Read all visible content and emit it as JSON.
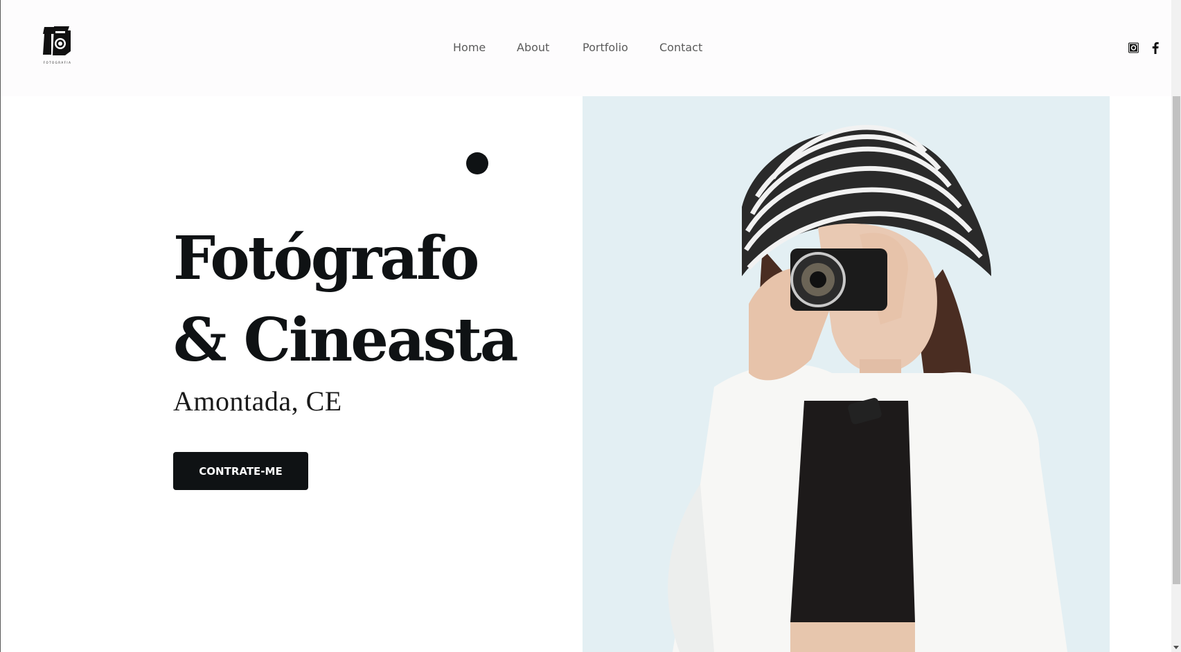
{
  "header": {
    "logo_icon": "camera-logo-icon",
    "logo_caption": "FOTOGRAFIA",
    "nav": [
      {
        "label": "Home"
      },
      {
        "label": "About"
      },
      {
        "label": "Portfolio"
      },
      {
        "label": "Contact"
      }
    ],
    "social": [
      {
        "icon": "instagram-icon"
      },
      {
        "icon": "facebook-icon"
      }
    ]
  },
  "hero": {
    "title_line1": "Fotógrafo",
    "title_line2": "& Cineasta",
    "subtitle": "Amontada, CE",
    "cta_label": "CONTRATE-ME",
    "decor_icon": "dot-icon"
  },
  "photo": {
    "subject_icon": "photographer-photo"
  },
  "colors": {
    "text_dark": "#0f1214",
    "nav_text": "#5b5b5b",
    "photo_bg": "#e3eff3"
  }
}
